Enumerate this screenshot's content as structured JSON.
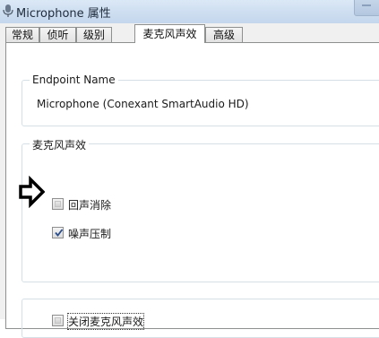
{
  "window": {
    "title": "Microphone 属性"
  },
  "tabs": [
    {
      "label": "常规",
      "active": false
    },
    {
      "label": "侦听",
      "active": false
    },
    {
      "label": "级别",
      "active": false
    },
    {
      "label": "麦克风声效",
      "active": true
    },
    {
      "label": "高级",
      "active": false
    }
  ],
  "endpoint": {
    "group_title": "Endpoint Name",
    "device_name": "Microphone (Conexant SmartAudio HD)"
  },
  "effects": {
    "group_title": "麦克风声效",
    "echo_cancel": {
      "label": "回声消除",
      "checked": false
    },
    "noise_suppress": {
      "label": "噪声压制",
      "checked": true
    }
  },
  "disable_all": {
    "label": "关闭麦克风声效",
    "checked": false
  },
  "annotation": {
    "icon": "right-arrow-icon",
    "color": "#000000"
  }
}
